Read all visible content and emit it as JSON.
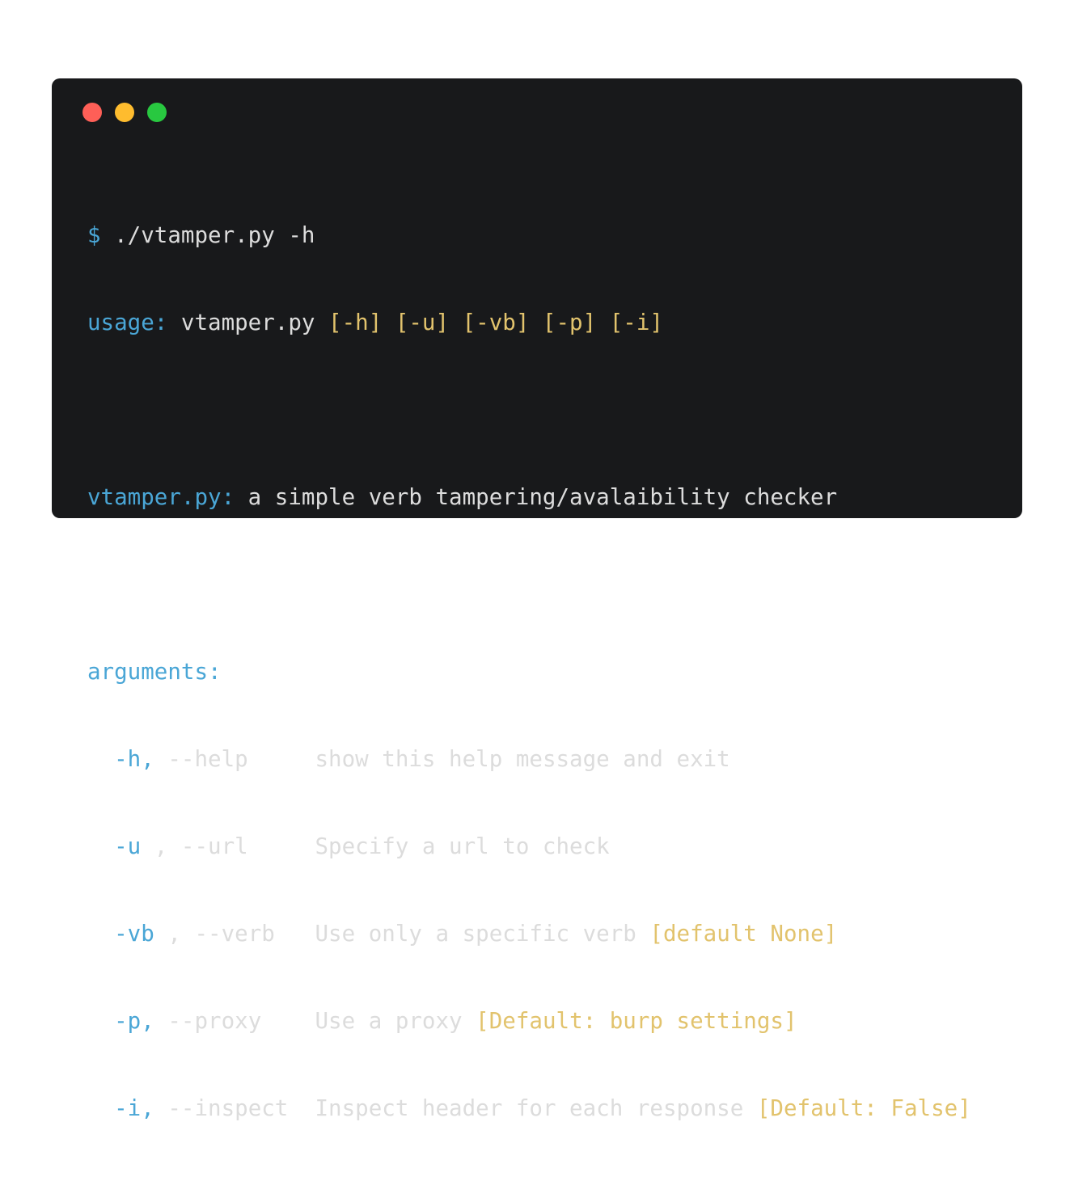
{
  "colors": {
    "window_bg": "#18191b",
    "close": "#fe5f57",
    "minimize": "#febc2e",
    "maximize": "#28c840",
    "text": "#dcdcdc",
    "accent_blue": "#4aa6d6",
    "accent_yellow": "#e2c36d"
  },
  "terminal": {
    "prompt": "$",
    "command": " ./vtamper.py -h",
    "usage_label": "usage:",
    "usage_prog": " vtamper.py ",
    "usage_opts": "[-h] [-u] [-vb] [-p] [-i]",
    "desc_prog": "vtamper.py:",
    "desc_text": " a simple verb tampering/avalaibility checker",
    "args_header": "arguments:",
    "args": [
      {
        "short": "  -h,",
        "long": " --help     ",
        "desc": "show this help message and exit",
        "default": ""
      },
      {
        "short": "  -u",
        "long": " , --url     ",
        "desc": "Specify a url to check",
        "default": ""
      },
      {
        "short": "  -vb",
        "long": " , --verb   ",
        "desc": "Use only a specific verb ",
        "default": "[default None]"
      },
      {
        "short": "  -p,",
        "long": " --proxy    ",
        "desc": "Use a proxy ",
        "default": "[Default: burp settings]"
      },
      {
        "short": "  -i,",
        "long": " --inspect  ",
        "desc": "Inspect header for each response ",
        "default": "[Default: False]"
      }
    ]
  }
}
